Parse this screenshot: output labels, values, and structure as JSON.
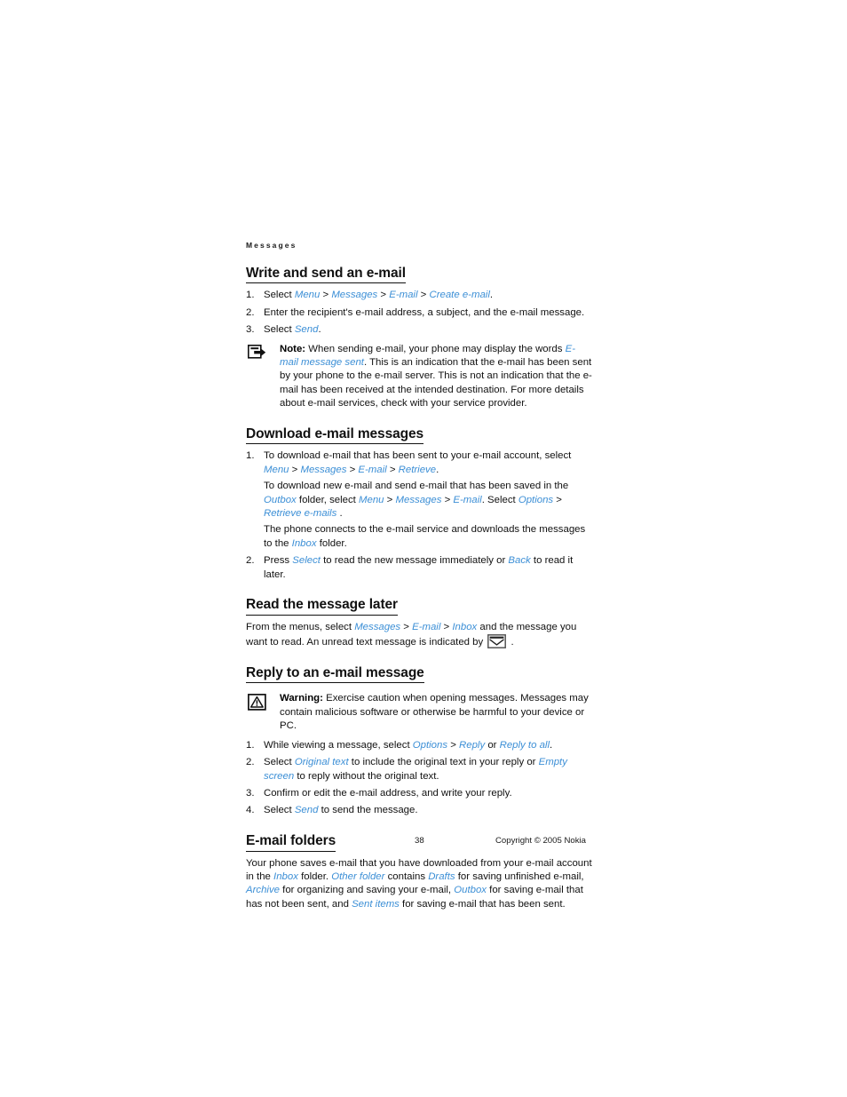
{
  "document": {
    "running_head": "Messages",
    "page_number": "38",
    "copyright": "Copyright © 2005 Nokia",
    "link_color": "#3c8fd6",
    "text_color": "#111111"
  },
  "sections": [
    {
      "id": "write-and-send",
      "title": "Write and send an e-mail",
      "steps": [
        {
          "num": "1.",
          "parts": [
            {
              "t": "Select ",
              "style": "plain"
            },
            {
              "t": "Menu",
              "style": "ui"
            },
            {
              "t": " > ",
              "style": "plain"
            },
            {
              "t": "Messages",
              "style": "ui"
            },
            {
              "t": " > ",
              "style": "plain"
            },
            {
              "t": "E-mail",
              "style": "ui"
            },
            {
              "t": " > ",
              "style": "plain"
            },
            {
              "t": "Create e-mail",
              "style": "ui"
            },
            {
              "t": ".",
              "style": "plain"
            }
          ]
        },
        {
          "num": "2.",
          "parts": [
            {
              "t": "Enter the recipient's e-mail address, a subject, and the e-mail message.",
              "style": "plain"
            }
          ]
        },
        {
          "num": "3.",
          "parts": [
            {
              "t": "Select ",
              "style": "plain"
            },
            {
              "t": "Send",
              "style": "ui"
            },
            {
              "t": ".",
              "style": "plain"
            }
          ]
        }
      ],
      "callout": {
        "kind": "note",
        "icon": "note-hand-icon",
        "label": "Note:",
        "parts": [
          {
            "t": " When sending e-mail, your phone may display the words ",
            "style": "plain"
          },
          {
            "t": "E-mail message sent",
            "style": "ui"
          },
          {
            "t": ". This is an indication that the e-mail has been sent by your phone to the e-mail server. This is not an indication that the e-mail has been received at the intended destination. For more details about e-mail services, check with your service provider.",
            "style": "plain"
          }
        ]
      }
    },
    {
      "id": "download-messages",
      "title": "Download e-mail messages",
      "steps": [
        {
          "num": "1.",
          "paragraphs": [
            [
              {
                "t": "To download e-mail that has been sent to your e-mail account, select ",
                "style": "plain"
              },
              {
                "t": "Menu",
                "style": "ui"
              },
              {
                "t": " > ",
                "style": "plain"
              },
              {
                "t": "Messages",
                "style": "ui"
              },
              {
                "t": " > ",
                "style": "plain"
              },
              {
                "t": "E-mail",
                "style": "ui"
              },
              {
                "t": " > ",
                "style": "plain"
              },
              {
                "t": "Retrieve",
                "style": "ui"
              },
              {
                "t": ".",
                "style": "plain"
              }
            ],
            [
              {
                "t": "To download new e-mail and send e-mail that has been saved in the ",
                "style": "plain"
              },
              {
                "t": "Outbox",
                "style": "ui"
              },
              {
                "t": " folder, select ",
                "style": "plain"
              },
              {
                "t": "Menu",
                "style": "ui"
              },
              {
                "t": " > ",
                "style": "plain"
              },
              {
                "t": "Messages",
                "style": "ui"
              },
              {
                "t": " > ",
                "style": "plain"
              },
              {
                "t": "E-mail",
                "style": "ui"
              },
              {
                "t": ". Select ",
                "style": "plain"
              },
              {
                "t": "Options",
                "style": "ui"
              },
              {
                "t": " > ",
                "style": "plain"
              },
              {
                "t": "Retrieve e-mails",
                "style": "ui"
              },
              {
                "t": " .",
                "style": "plain"
              }
            ],
            [
              {
                "t": "The phone connects to the e-mail service and downloads the messages to the ",
                "style": "plain"
              },
              {
                "t": "Inbox",
                "style": "ui"
              },
              {
                "t": " folder.",
                "style": "plain"
              }
            ]
          ]
        },
        {
          "num": "2.",
          "paragraphs": [
            [
              {
                "t": "Press ",
                "style": "plain"
              },
              {
                "t": "Select",
                "style": "ui"
              },
              {
                "t": " to read the new message immediately or ",
                "style": "plain"
              },
              {
                "t": "Back",
                "style": "ui"
              },
              {
                "t": " to read it later.",
                "style": "plain"
              }
            ]
          ]
        }
      ]
    },
    {
      "id": "read-later",
      "title": "Read the message later",
      "paragraphs": [
        [
          {
            "t": "From the menus, select ",
            "style": "plain"
          },
          {
            "t": "Messages",
            "style": "ui"
          },
          {
            "t": " > ",
            "style": "plain"
          },
          {
            "t": "E-mail",
            "style": "ui"
          },
          {
            "t": " > ",
            "style": "plain"
          },
          {
            "t": "Inbox",
            "style": "ui"
          },
          {
            "t": " and the message you want to read. An unread text message is indicated by ",
            "style": "plain"
          },
          {
            "t": "",
            "style": "icon-envelope"
          },
          {
            "t": " .",
            "style": "plain"
          }
        ]
      ]
    },
    {
      "id": "reply-message",
      "title": "Reply to an e-mail message",
      "callout": {
        "kind": "warning",
        "icon": "warning-triangle-icon",
        "label": "Warning:",
        "parts": [
          {
            "t": " Exercise caution when opening messages. Messages may contain malicious software or otherwise be harmful to your device or PC.",
            "style": "plain"
          }
        ]
      },
      "steps": [
        {
          "num": "1.",
          "parts": [
            {
              "t": "While viewing a message, select ",
              "style": "plain"
            },
            {
              "t": "Options",
              "style": "ui"
            },
            {
              "t": " > ",
              "style": "plain"
            },
            {
              "t": "Reply",
              "style": "ui"
            },
            {
              "t": " or ",
              "style": "plain"
            },
            {
              "t": "Reply to all",
              "style": "ui"
            },
            {
              "t": ".",
              "style": "plain"
            }
          ]
        },
        {
          "num": "2.",
          "parts": [
            {
              "t": "Select ",
              "style": "plain"
            },
            {
              "t": "Original text",
              "style": "ui"
            },
            {
              "t": " to include the original text in your reply or ",
              "style": "plain"
            },
            {
              "t": "Empty screen",
              "style": "ui"
            },
            {
              "t": " to reply without the original text.",
              "style": "plain"
            }
          ]
        },
        {
          "num": "3.",
          "parts": [
            {
              "t": "Confirm or edit the e-mail address, and write your reply.",
              "style": "plain"
            }
          ]
        },
        {
          "num": "4.",
          "parts": [
            {
              "t": "Select  ",
              "style": "plain"
            },
            {
              "t": "Send",
              "style": "ui"
            },
            {
              "t": " to send the message.",
              "style": "plain"
            }
          ]
        }
      ]
    },
    {
      "id": "email-folders",
      "title": "E-mail folders",
      "paragraphs": [
        [
          {
            "t": "Your phone saves e-mail that you have downloaded from your e-mail account in the ",
            "style": "plain"
          },
          {
            "t": "Inbox",
            "style": "ui"
          },
          {
            "t": " folder. ",
            "style": "plain"
          },
          {
            "t": "Other folder",
            "style": "ui"
          },
          {
            "t": " contains ",
            "style": "plain"
          },
          {
            "t": "Drafts",
            "style": "ui"
          },
          {
            "t": " for saving unfinished e-mail, ",
            "style": "plain"
          },
          {
            "t": "Archive",
            "style": "ui"
          },
          {
            "t": " for organizing and saving your e-mail, ",
            "style": "plain"
          },
          {
            "t": "Outbox",
            "style": "ui"
          },
          {
            "t": " for saving e-mail that has not been sent, and ",
            "style": "plain"
          },
          {
            "t": "Sent items",
            "style": "ui"
          },
          {
            "t": " for saving e-mail that has been sent.",
            "style": "plain"
          }
        ]
      ]
    }
  ]
}
